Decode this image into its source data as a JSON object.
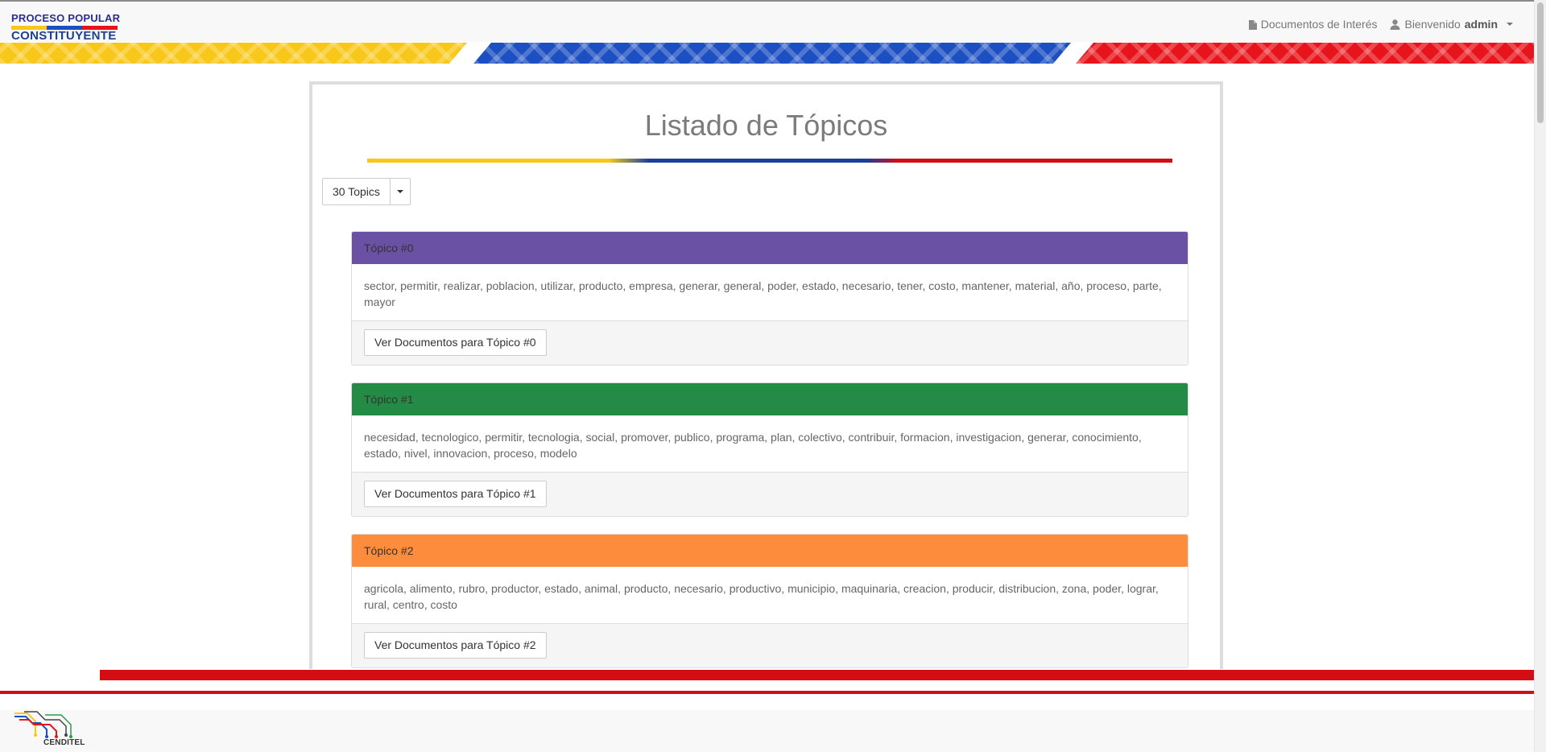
{
  "header": {
    "logo_line1_parts": [
      "PROCESO",
      " ",
      "POPULAR"
    ],
    "logo_line2": "CONSTITUYENTE",
    "nav": {
      "documents_label": "Documentos de Interés",
      "welcome_label": "Bienvenido",
      "username": "admin"
    }
  },
  "main": {
    "title": "Listado de Tópicos",
    "topic_count_label": "30 Topics",
    "topics": [
      {
        "title": "Tópico #0",
        "color": "#6a51a3",
        "words": "sector, permitir, realizar, poblacion, utilizar, producto, empresa, generar, general, poder, estado, necesario, tener, costo, mantener, material, año, proceso, parte, mayor",
        "button": "Ver Documentos para Tópico #0"
      },
      {
        "title": "Tópico #1",
        "color": "#238b45",
        "words": "necesidad, tecnologico, permitir, tecnologia, social, promover, publico, programa, plan, colectivo, contribuir, formacion, investigacion, generar, conocimiento, estado, nivel, innovacion, proceso, modelo",
        "button": "Ver Documentos para Tópico #1"
      },
      {
        "title": "Tópico #2",
        "color": "#fd8d3c",
        "words": "agricola, alimento, rubro, productor, estado, animal, producto, necesario, productivo, municipio, maquinaria, creacion, producir, distribucion, zona, poder, lograr, rural, centro, costo",
        "button": "Ver Documentos para Tópico #2"
      }
    ]
  },
  "footer": {
    "logo_text": "CENDITEL"
  },
  "colors": {
    "flag_yellow": "#f7c81a",
    "flag_blue": "#1c4fc2",
    "flag_red": "#e8141b"
  }
}
